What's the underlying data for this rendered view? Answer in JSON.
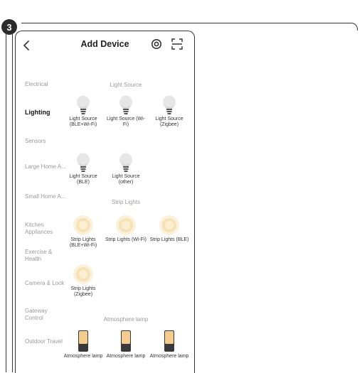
{
  "step_number": "3",
  "header": {
    "title": "Add Device"
  },
  "sidebar": {
    "items": [
      {
        "label": "Electrical",
        "active": false
      },
      {
        "label": "Lighting",
        "active": true
      },
      {
        "label": "Sensors",
        "active": false
      },
      {
        "label": "Large Home A...",
        "active": false
      },
      {
        "label": "Small Home A...",
        "active": false
      },
      {
        "label": "Kitchen Appliances",
        "active": false
      },
      {
        "label": "Exercise & Health",
        "active": false
      },
      {
        "label": "Camera & Lock",
        "active": false
      },
      {
        "label": "Gateway Control",
        "active": false
      },
      {
        "label": "Outdoor Travel",
        "active": false
      }
    ]
  },
  "sections": [
    {
      "title": "Light Source",
      "icon": "bulb-icon",
      "devices": [
        {
          "label": "Light Source (BLE+Wi-Fi)"
        },
        {
          "label": "Light Source (Wi-Fi)"
        },
        {
          "label": "Light Source (Zigbee)"
        },
        {
          "label": "Light Source (BLE)"
        },
        {
          "label": "Light Source (other)"
        }
      ]
    },
    {
      "title": "Strip Lights",
      "icon": "strip-light-icon",
      "devices": [
        {
          "label": "Strip Lights (BLE+Wi-Fi)"
        },
        {
          "label": "Strip Lights (Wi-Fi)"
        },
        {
          "label": "Strip Lights (BLE)"
        },
        {
          "label": "Strip Lights (Zigbee)"
        }
      ]
    },
    {
      "title": "Atmosphere lamp",
      "icon": "atmosphere-lamp-icon",
      "devices": [
        {
          "label": "Atmosphere lamp"
        },
        {
          "label": "Atmosphere lamp"
        },
        {
          "label": "Atmosphere lamp"
        }
      ]
    }
  ],
  "colors": {
    "bulb": "#c8c8c8",
    "strip": "#f3d99a",
    "lamp_top": "#f5c98a",
    "lamp_base": "#3a3a3a"
  }
}
